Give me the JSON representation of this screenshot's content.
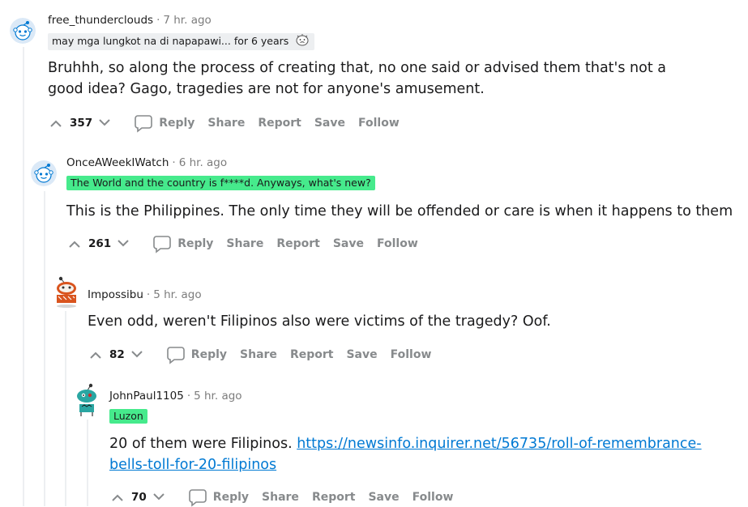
{
  "comments": [
    {
      "username": "free_thunderclouds",
      "time": "7 hr. ago",
      "flair": "may mga lungkot na di napapawi... for 6 years",
      "flair_style": "grey",
      "flair_emoji": "face-emoji",
      "body": "Bruhhh, so along the process of creating that, no one said or advised them that's not a good idea? Gago, tragedies are not for anyone's amusement.",
      "score": "357",
      "actions": {
        "reply": "Reply",
        "share": "Share",
        "report": "Report",
        "save": "Save",
        "follow": "Follow"
      }
    },
    {
      "username": "OnceAWeekIWatch",
      "time": "6 hr. ago",
      "flair": "The World and the country is f****d. Anyways, what's new?",
      "flair_style": "green",
      "body": "This is the Philippines. The only time they will be offended or care is when it happens to them",
      "score": "261",
      "actions": {
        "reply": "Reply",
        "share": "Share",
        "report": "Report",
        "save": "Save",
        "follow": "Follow"
      }
    },
    {
      "username": "Impossibu",
      "time": "5 hr. ago",
      "body": "Even odd, weren't Filipinos also were victims of the tragedy? Oof.",
      "score": "82",
      "actions": {
        "reply": "Reply",
        "share": "Share",
        "report": "Report",
        "save": "Save",
        "follow": "Follow"
      }
    },
    {
      "username": "JohnPaul1105",
      "time": "5 hr. ago",
      "flair": "Luzon",
      "flair_style": "green",
      "body_prefix": "20 of them were Filipinos. ",
      "link_line1": "https://newsinfo.inquirer.net/56735/roll-of-remembrance-",
      "link_line2": "bells-toll-for-20-filipinos",
      "score": "70",
      "actions": {
        "reply": "Reply",
        "share": "Share",
        "report": "Report",
        "save": "Save",
        "follow": "Follow"
      }
    }
  ],
  "separator": "·",
  "colors": {
    "flair_green": "#46ea8c",
    "flair_grey": "#edeff1",
    "link": "#0079d3",
    "meta_grey": "#7c7c7c",
    "action_grey": "#878a8c",
    "thread_line": "#edeff1"
  }
}
